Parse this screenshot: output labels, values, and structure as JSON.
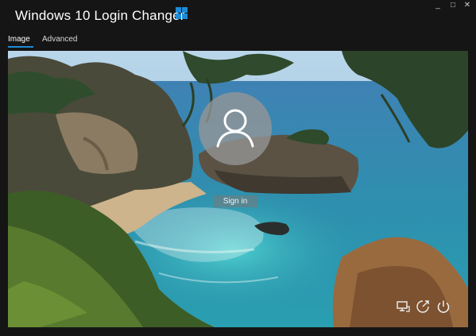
{
  "window": {
    "title": "Windows 10 Login Changer",
    "accent_color": "#1e8ad6",
    "controls": [
      {
        "name": "minimize-button",
        "glyph": "_"
      },
      {
        "name": "maximize-button",
        "glyph": "□"
      },
      {
        "name": "close-button",
        "glyph": "✕"
      }
    ]
  },
  "tabs": [
    {
      "label": "Image",
      "active": true
    },
    {
      "label": "Advanced",
      "active": false
    }
  ],
  "preview": {
    "background": "seaside-cliffs-photo",
    "avatar_icon": "user-icon",
    "signin_label": "Sign in",
    "system_icons": [
      "network-icon",
      "accessibility-icon",
      "power-icon"
    ]
  }
}
